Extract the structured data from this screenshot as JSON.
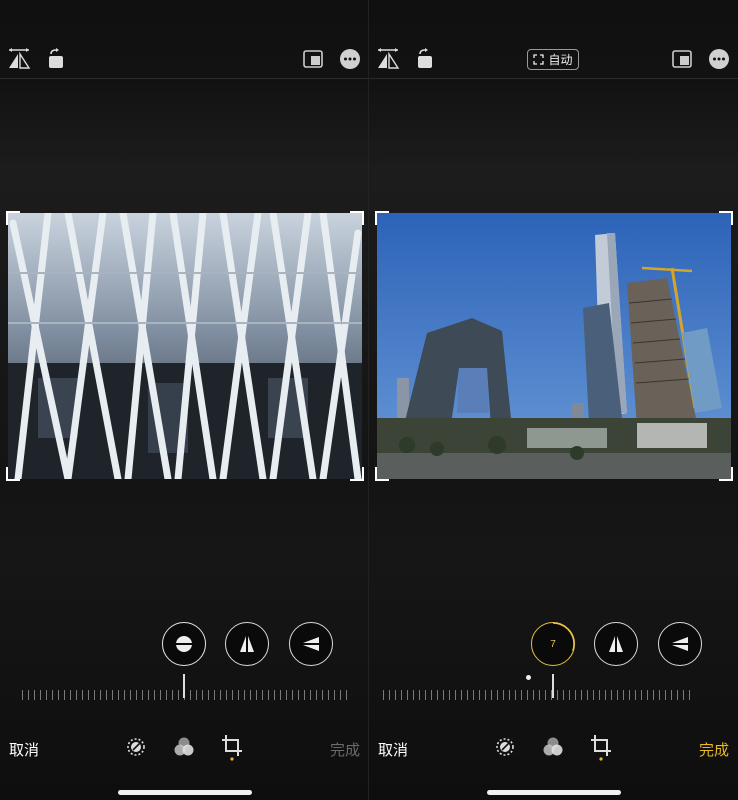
{
  "left": {
    "cancel_label": "取消",
    "done_label": "完成",
    "done_color": "#6b6b6b",
    "active_control": "none"
  },
  "right": {
    "auto_label": "自动",
    "cancel_label": "取消",
    "done_label": "完成",
    "done_color": "#e8b923",
    "vertical_value": "7"
  },
  "icons": {
    "toolbar": [
      "flip-icon",
      "rotate-icon",
      "aspect-ratio-icon",
      "more-icon"
    ],
    "controls": [
      "horizon-straighten-icon",
      "vertical-perspective-icon",
      "horizontal-perspective-icon"
    ],
    "bottom": [
      "adjust-icon",
      "filters-icon",
      "crop-icon"
    ]
  },
  "colors": {
    "accent": "#e8b923",
    "sky": "#3d72c4"
  }
}
